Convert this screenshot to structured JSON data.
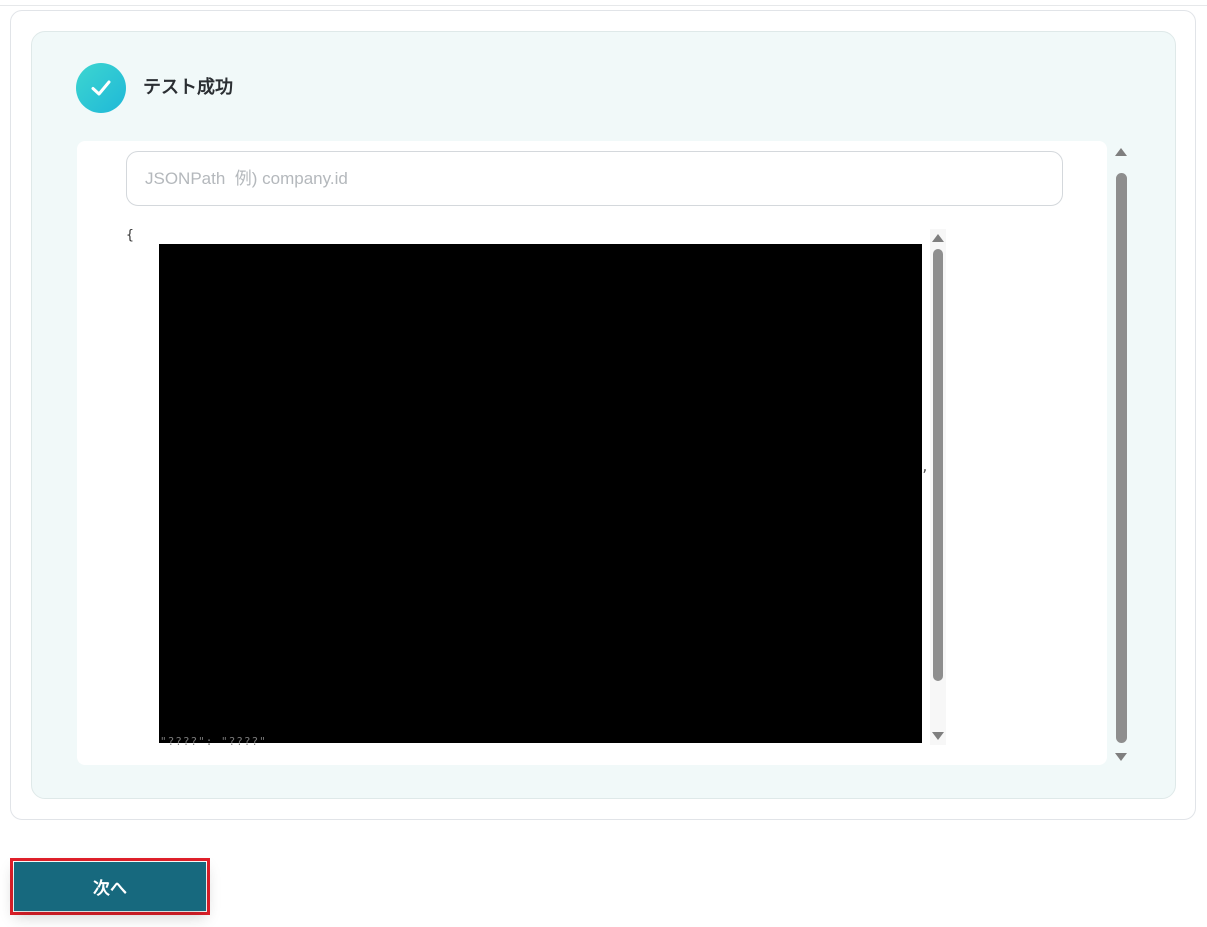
{
  "result": {
    "status_title": "テスト成功",
    "status_icon": "check-circle-icon",
    "accent_color": "#22c3d4"
  },
  "viewer": {
    "search_placeholder": "JSONPath  例) company.id",
    "json_open": "{",
    "json_comma": ",",
    "json_trailing": "\"????\": \"????\""
  },
  "footer": {
    "next_label": "次へ",
    "next_color": "#17697e",
    "highlight_color": "#e2202a"
  }
}
